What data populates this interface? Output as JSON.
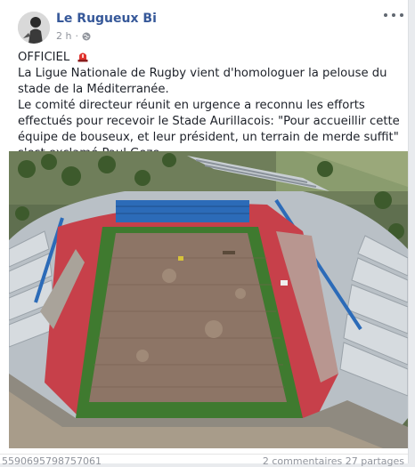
{
  "post": {
    "author": "Le Rugueux Bi",
    "time": "2 h",
    "privacy_icon": "globe-icon",
    "more_icon": "more-options-icon",
    "line1": "OFFICIEL",
    "line1_icon": "siren-icon",
    "paragraph1": "La Ligue Nationale de Rugby vient d'homologuer la pelouse du stade de la Méditerranée.",
    "paragraph2": "Le comité directeur réunit en urgence a reconnu les efforts effectués pour recevoir le Stade Aurillacois: \"Pour accueillir cette équipe de bouseux, et leur président, un terrain de merde suffit\" s'est exclamé Paul Goze."
  },
  "footer": {
    "left": "5590695798757061",
    "right": "2 commentaires   27 partages"
  },
  "colors": {
    "author": "#365899",
    "pitch_dirt": "#8d7566",
    "grass": "#3f7a2f",
    "seats_red": "#c7404a",
    "seats_blue": "#2c6bb8"
  }
}
